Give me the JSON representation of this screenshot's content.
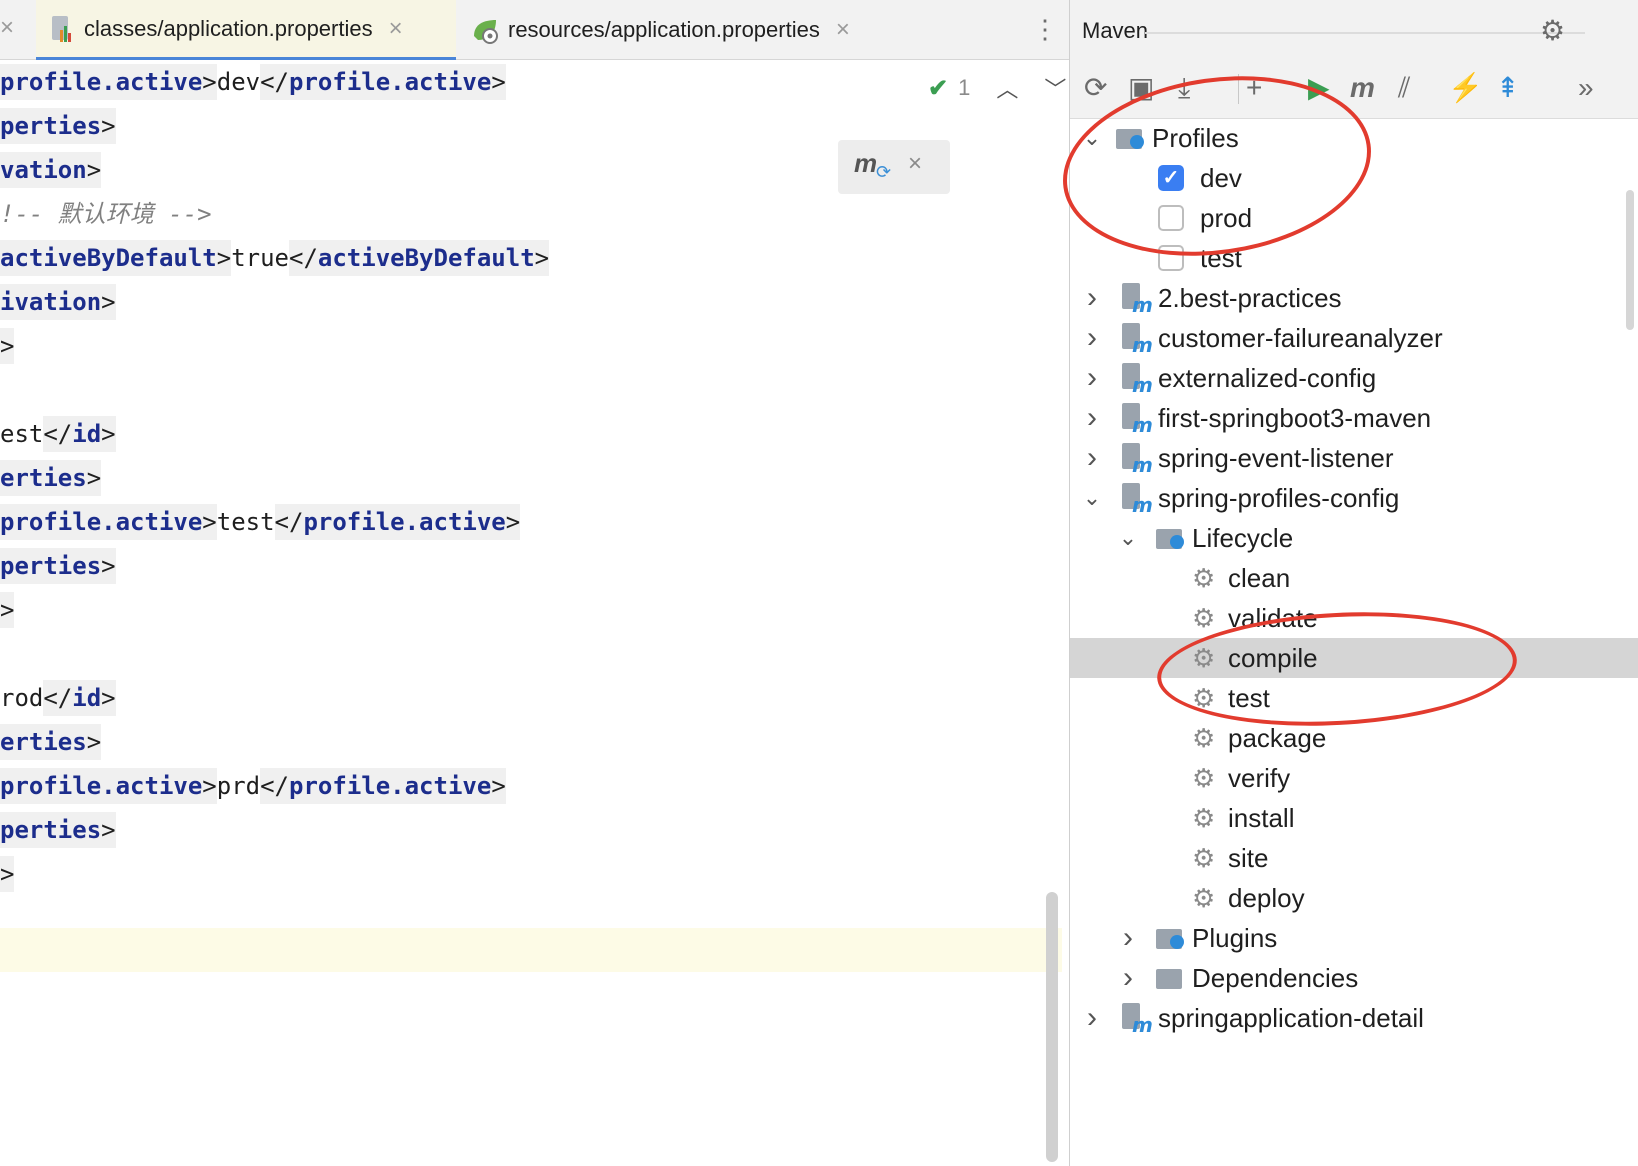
{
  "editor": {
    "tabs": [
      {
        "label": "classes/application.properties",
        "active": true
      },
      {
        "label": "resources/application.properties",
        "active": false
      }
    ],
    "close_glyph": "×",
    "menu_glyph": "⋮",
    "inspections": {
      "count": "1"
    },
    "code_lines": [
      [
        [
          "tag",
          "profile.active"
        ],
        [
          "pun",
          ">"
        ],
        [
          "txt",
          "dev"
        ],
        [
          "pun",
          "</"
        ],
        [
          "tag",
          "profile.active"
        ],
        [
          "pun",
          ">"
        ]
      ],
      [
        [
          "tag",
          "perties"
        ],
        [
          "pun",
          ">"
        ]
      ],
      [
        [
          "tag",
          "vation"
        ],
        [
          "pun",
          ">"
        ]
      ],
      [
        [
          "cmt",
          "!-- 默认环境 -->"
        ]
      ],
      [
        [
          "tag",
          "activeByDefault"
        ],
        [
          "pun",
          ">"
        ],
        [
          "txt",
          "true"
        ],
        [
          "pun",
          "</"
        ],
        [
          "tag",
          "activeByDefault"
        ],
        [
          "pun",
          ">"
        ]
      ],
      [
        [
          "tag",
          "ivation"
        ],
        [
          "pun",
          ">"
        ]
      ],
      [
        [
          "pun",
          ">"
        ]
      ],
      [],
      [
        [
          "txt",
          "est"
        ],
        [
          "pun",
          "</"
        ],
        [
          "tag",
          "id"
        ],
        [
          "pun",
          ">"
        ]
      ],
      [
        [
          "tag",
          "erties"
        ],
        [
          "pun",
          ">"
        ]
      ],
      [
        [
          "tag",
          "profile.active"
        ],
        [
          "pun",
          ">"
        ],
        [
          "txt",
          "test"
        ],
        [
          "pun",
          "</"
        ],
        [
          "tag",
          "profile.active"
        ],
        [
          "pun",
          ">"
        ]
      ],
      [
        [
          "tag",
          "perties"
        ],
        [
          "pun",
          ">"
        ]
      ],
      [
        [
          "pun",
          ">"
        ]
      ],
      [],
      [
        [
          "txt",
          "rod"
        ],
        [
          "pun",
          "</"
        ],
        [
          "tag",
          "id"
        ],
        [
          "pun",
          ">"
        ]
      ],
      [
        [
          "tag",
          "erties"
        ],
        [
          "pun",
          ">"
        ]
      ],
      [
        [
          "tag",
          "profile.active"
        ],
        [
          "pun",
          ">"
        ],
        [
          "txt",
          "prd"
        ],
        [
          "pun",
          "</"
        ],
        [
          "tag",
          "profile.active"
        ],
        [
          "pun",
          ">"
        ]
      ],
      [
        [
          "tag",
          "perties"
        ],
        [
          "pun",
          ">"
        ]
      ],
      [
        [
          "pun",
          ">"
        ]
      ],
      [],
      []
    ]
  },
  "maven": {
    "title": "Maven",
    "toolbar": [
      {
        "name": "reload-icon",
        "glyph": "⟳"
      },
      {
        "name": "add-folder-icon",
        "glyph": "▣"
      },
      {
        "name": "download-icon",
        "glyph": "⤓"
      },
      {
        "name": "add-icon",
        "glyph": "+"
      },
      {
        "name": "run-icon",
        "glyph": "▶"
      },
      {
        "name": "maven-goal-icon",
        "glyph": "m"
      },
      {
        "name": "skip-tests-icon",
        "glyph": "⫽"
      },
      {
        "name": "offline-icon",
        "glyph": "⚡"
      },
      {
        "name": "collapse-icon",
        "glyph": "⇞"
      },
      {
        "name": "more-icon",
        "glyph": "»"
      }
    ],
    "tree": {
      "profiles_label": "Profiles",
      "profiles": [
        {
          "label": "dev",
          "checked": true
        },
        {
          "label": "prod",
          "checked": false
        },
        {
          "label": "test",
          "checked": false
        }
      ],
      "modules_before": [
        "2.best-practices",
        "customer-failureanalyzer",
        "externalized-config",
        "first-springboot3-maven",
        "spring-event-listener"
      ],
      "expanded_module": "spring-profiles-config",
      "lifecycle_label": "Lifecycle",
      "lifecycle": [
        "clean",
        "validate",
        "compile",
        "test",
        "package",
        "verify",
        "install",
        "site",
        "deploy"
      ],
      "selected_goal": "compile",
      "plugins_label": "Plugins",
      "dependencies_label": "Dependencies",
      "modules_after": [
        "springapplication-detail"
      ]
    }
  },
  "colors": {
    "annotation": "#e23b2e",
    "tag": "#1c2d8c",
    "accent": "#3a7ef2"
  }
}
